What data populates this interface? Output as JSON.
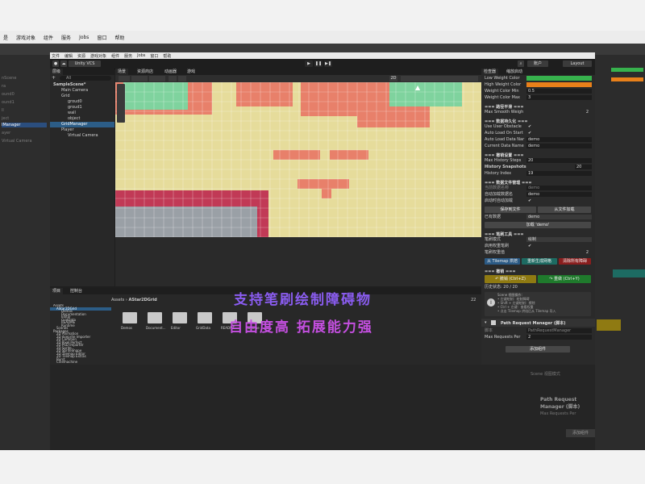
{
  "outer": {
    "menu": [
      "是",
      "游戏对象",
      "组件",
      "服务",
      "Jobs",
      "窗口",
      "帮助"
    ],
    "left_items": [
      "nScene",
      "ra",
      "ound0",
      "ound1",
      "ll",
      "ject",
      "IManager",
      "ayer",
      "Virtual Camera"
    ],
    "bottom_items": [
      "Scene 视图模式",
      "• 左键绘制",
      "• Shift+左键",
      "• Ctrl+左键",
      "• 点击 Tilemap"
    ],
    "bottom_right": [
      "Path Request Manager (脚本)",
      "Max Requests Per",
      "添加组件"
    ]
  },
  "editor": {
    "menu": [
      "文件",
      "编辑",
      "资源",
      "游戏对象",
      "组件",
      "服务",
      "Jobs",
      "窗口",
      "帮助"
    ],
    "toolbar": {
      "account": "账户",
      "layout": "Layout",
      "vcs": "Unity VCS"
    },
    "hierarchy": {
      "tab": "层级",
      "search_label": "All",
      "items": [
        "SampleScene*",
        "Main Camera",
        "Grid",
        "groud0",
        "groud1",
        "wall",
        "object",
        "GridManager",
        "Player",
        "Virtual Camera"
      ]
    },
    "scene": {
      "tabs": [
        "场景",
        "资源商店",
        "动画器",
        "游戏"
      ],
      "shading": "2D",
      "pivot": "Pivot"
    },
    "project": {
      "tabs": [
        "项目",
        "控制台"
      ],
      "breadcrumb": [
        "Assets",
        "AStar2DGrid"
      ],
      "count": "22",
      "tree": [
        "Assets",
        "AStar2DGrid",
        "Demos",
        "Documentation",
        "Editor",
        "GridData",
        "README",
        "Runtime",
        "Scenes",
        "Packages",
        "2D Animation",
        "2D Aseprite Importer",
        "2D Common",
        "2D Pixel Perfect",
        "2D PSD Importer",
        "2D Sprite",
        "2D SpriteShape",
        "2D Tilemap Editor",
        "2D Tilemap Extras",
        "Burst",
        "Cinemachine"
      ],
      "folders": [
        "Demos",
        "Document...",
        "Editor",
        "GridData",
        "README",
        "Runtime"
      ]
    },
    "overlay": {
      "line1": "支持笔刷绘制障碍物",
      "line2": "自由度高 拓展能力强"
    },
    "inspector": {
      "tabs": [
        "检查器",
        "缩放启动"
      ],
      "rows1": [
        {
          "label": "Low Weight Color",
          "value": ""
        },
        {
          "label": "High Weight Color",
          "value": ""
        },
        {
          "label": "Weight Color Min",
          "value": "0.5"
        },
        {
          "label": "Weight Color Max",
          "value": "3"
        }
      ],
      "sec_smooth": "=== 路径平滑 ===",
      "smooth": {
        "label": "Max Smooth Weigh",
        "value": "2"
      },
      "sec_persist": "=== 数据持久化 ===",
      "persist": [
        {
          "label": "Use User Obstacle",
          "value": "✔"
        },
        {
          "label": "Auto Load On Start",
          "value": "✔"
        },
        {
          "label": "Auto Load Data Nar",
          "value": "demo"
        },
        {
          "label": "Current Data Name",
          "value": "demo"
        }
      ],
      "sec_history": "=== 撤销设置 ===",
      "history": [
        {
          "label": "Max History Steps",
          "value": "20"
        },
        {
          "label": "History Snapshots",
          "value": "20"
        },
        {
          "label": "History Index",
          "value": "19"
        }
      ],
      "sec_data": "=== 数据文件管理 ===",
      "data_rows": [
        {
          "label": "当前数据名称",
          "value": "demo"
        },
        {
          "label": "自动加载数据名",
          "value": "demo"
        },
        {
          "label": "启动时自动加载",
          "value": "✔"
        }
      ],
      "save_btn": "保存到文件",
      "load_btn": "从文件加载",
      "existing_label": "已有数据",
      "existing_value": "demo",
      "load_demo_btn": "加载 'demo'",
      "sec_brush": "=== 笔刷工具 ===",
      "brush": [
        {
          "label": "笔刷模式",
          "value": "绘制"
        },
        {
          "label": "启用权重笔刷",
          "value": "✔"
        },
        {
          "label": "笔刷权重值",
          "value": "2"
        }
      ],
      "tilemap_btn": "从 Tilemap 烘焙",
      "rebuild_btn": "重新生成网格",
      "clear_btn": "清除所有障碍",
      "sec_undo": "=== 撤销 ===",
      "undo_btn": "↶ 撤销 (Ctrl+Z)",
      "redo_btn": "↷ 重做 (Ctrl+Y)",
      "history_state": "历史状态: 20 / 20",
      "help_title": "Scene 视图操作：",
      "help_lines": [
        "• 左键绘制：绘制障碍",
        "• Shift + 左键绘制：擦除",
        "• Ctrl + 左键：查看权重",
        "• 点击 Tilemap 烘焙后从 Tilemap 导入"
      ],
      "component_title": "Path Request Manager (脚本)",
      "script_label": "脚本",
      "script_value": "PathRequestManager",
      "max_req_label": "Max Requests Per",
      "max_req_value": "2",
      "add_component": "添加组件"
    }
  },
  "colors": {
    "accent": "#2c5d87",
    "tile_sand": "#e6dc9b",
    "tile_red": "#e8806a",
    "tile_green": "#7fd39e",
    "overlay1": "#8a5cf0",
    "overlay2": "#c44fe0"
  }
}
